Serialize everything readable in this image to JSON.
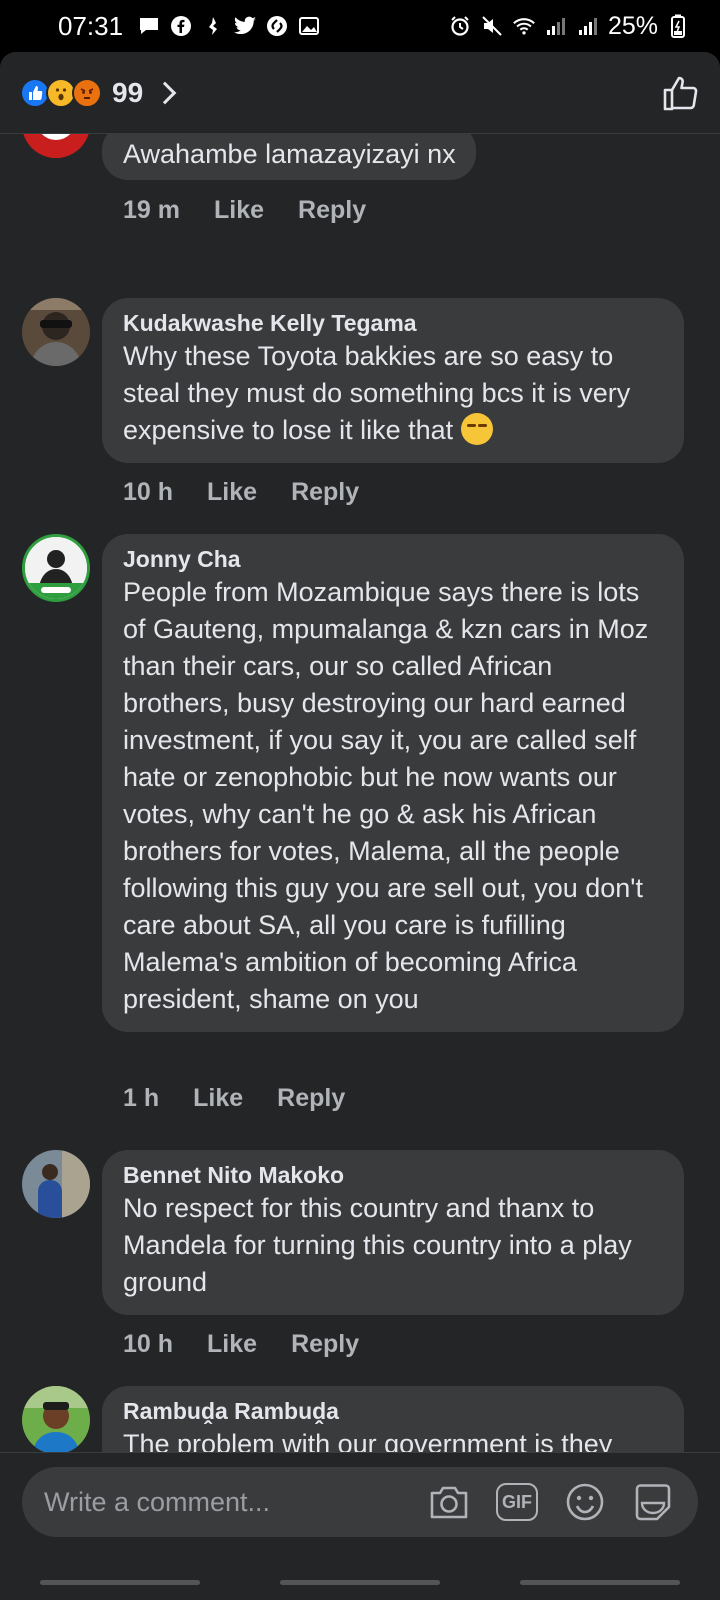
{
  "status_bar": {
    "time": "07:31",
    "battery": "25%",
    "left_icons": [
      "message-icon",
      "facebook-icon",
      "notification-icon",
      "twitter-icon",
      "shazam-icon",
      "gallery-icon"
    ],
    "right_icons": [
      "alarm-icon",
      "mute-icon",
      "wifi-icon",
      "signal-icon",
      "signal-icon",
      "battery-icon"
    ]
  },
  "reactions": {
    "count": "99",
    "types": [
      "like",
      "wow",
      "angry"
    ]
  },
  "comments": [
    {
      "author": "",
      "text": "Awahambe lamazayizayi nx",
      "time": "19 m",
      "like": "Like",
      "reply": "Reply"
    },
    {
      "author": "Kudakwashe Kelly Tegama",
      "text": "Why these Toyota bakkies are so easy to steal they must do something bcs it is very expensive to lose it like that",
      "time": "10 h",
      "like": "Like",
      "reply": "Reply"
    },
    {
      "author": "Jonny Cha",
      "text": "People from Mozambique says there is lots of Gauteng, mpumalanga & kzn cars in Moz than their cars, our so called African brothers, busy destroying our hard earned investment, if you say it, you are called self hate or zenophobic but he now wants our votes, why can't he go & ask his African brothers for votes, Malema, all the people following this guy you are sell out, you don't care about SA, all you care is fufilling Malema's ambition of becoming Africa president, shame on you",
      "time": "1 h",
      "like": "Like",
      "reply": "Reply"
    },
    {
      "author": "Bennet Nito Makoko",
      "text": "No respect for this country and thanx to Mandela for turning this country into a play ground",
      "time": "10 h",
      "like": "Like",
      "reply": "Reply"
    },
    {
      "author": "Rambuḓa Rambuḓa",
      "text": "The problem with our government is they don't take things seriously",
      "time": "",
      "like": "",
      "reply": ""
    }
  ],
  "composer": {
    "placeholder": "Write a comment...",
    "gif_label": "GIF"
  },
  "colors": {
    "background": "#242526",
    "bubble": "#3a3b3c",
    "text": "#e4e6eb",
    "muted": "#b0b3b8",
    "like_blue": "#1877f2"
  }
}
